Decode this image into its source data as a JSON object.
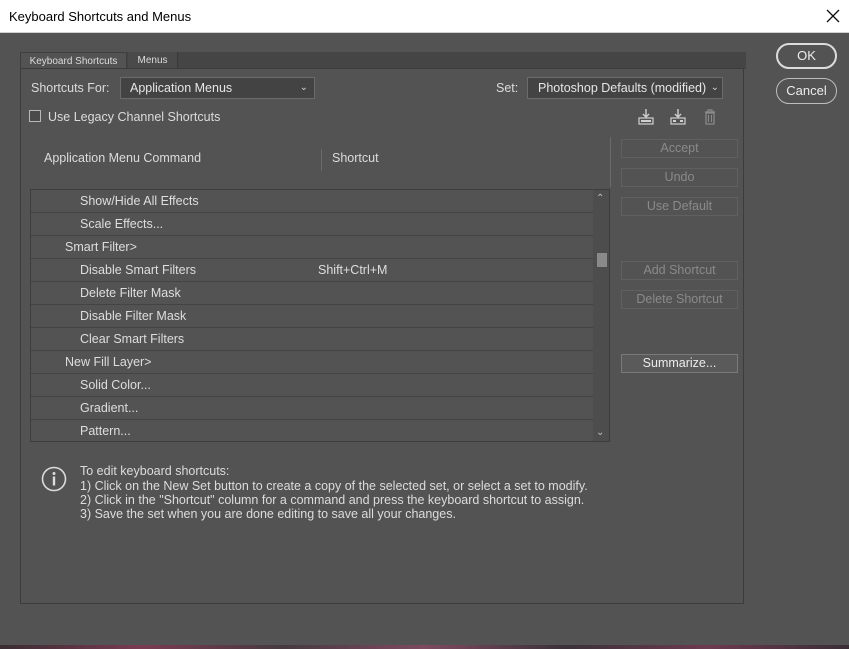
{
  "window": {
    "title": "Keyboard Shortcuts and Menus"
  },
  "tabs": [
    {
      "label": "Keyboard Shortcuts",
      "active": true
    },
    {
      "label": "Menus",
      "active": false
    }
  ],
  "controls": {
    "shortcuts_for_label": "Shortcuts For:",
    "shortcuts_for_value": "Application Menus",
    "set_label": "Set:",
    "set_value": "Photoshop Defaults (modified)",
    "legacy_checkbox_label": "Use Legacy Channel Shortcuts",
    "legacy_checked": false
  },
  "table": {
    "col_command": "Application Menu Command",
    "col_shortcut": "Shortcut",
    "rows": [
      {
        "command": "Show/Hide All Effects",
        "shortcut": "",
        "level": 2
      },
      {
        "command": "Scale Effects...",
        "shortcut": "",
        "level": 2
      },
      {
        "command": "Smart Filter>",
        "shortcut": "",
        "level": 1
      },
      {
        "command": "Disable Smart Filters",
        "shortcut": "Shift+Ctrl+M",
        "level": 2
      },
      {
        "command": "Delete Filter Mask",
        "shortcut": "",
        "level": 2
      },
      {
        "command": "Disable Filter Mask",
        "shortcut": "",
        "level": 2
      },
      {
        "command": "Clear Smart Filters",
        "shortcut": "",
        "level": 2
      },
      {
        "command": "New Fill Layer>",
        "shortcut": "",
        "level": 1
      },
      {
        "command": "Solid Color...",
        "shortcut": "",
        "level": 2
      },
      {
        "command": "Gradient...",
        "shortcut": "",
        "level": 2
      },
      {
        "command": "Pattern...",
        "shortcut": "",
        "level": 2
      }
    ]
  },
  "side_buttons": {
    "accept": "Accept",
    "undo": "Undo",
    "use_default": "Use Default",
    "add_shortcut": "Add Shortcut",
    "delete_shortcut": "Delete Shortcut",
    "summarize": "Summarize..."
  },
  "dialog_buttons": {
    "ok": "OK",
    "cancel": "Cancel"
  },
  "info": {
    "line1": "To edit keyboard shortcuts:",
    "line2": "1) Click on the New Set button to create a copy of the selected set, or select a set to modify.",
    "line3": "2) Click in the \"Shortcut\" column for a command and press the keyboard shortcut to assign.",
    "line4": "3) Save the set when you are done editing to save all your changes."
  },
  "icons": {
    "save_set": "save-set-icon",
    "save_set_as": "new-set-icon",
    "delete_set": "trash-icon",
    "info": "info-icon",
    "close": "close-icon"
  }
}
